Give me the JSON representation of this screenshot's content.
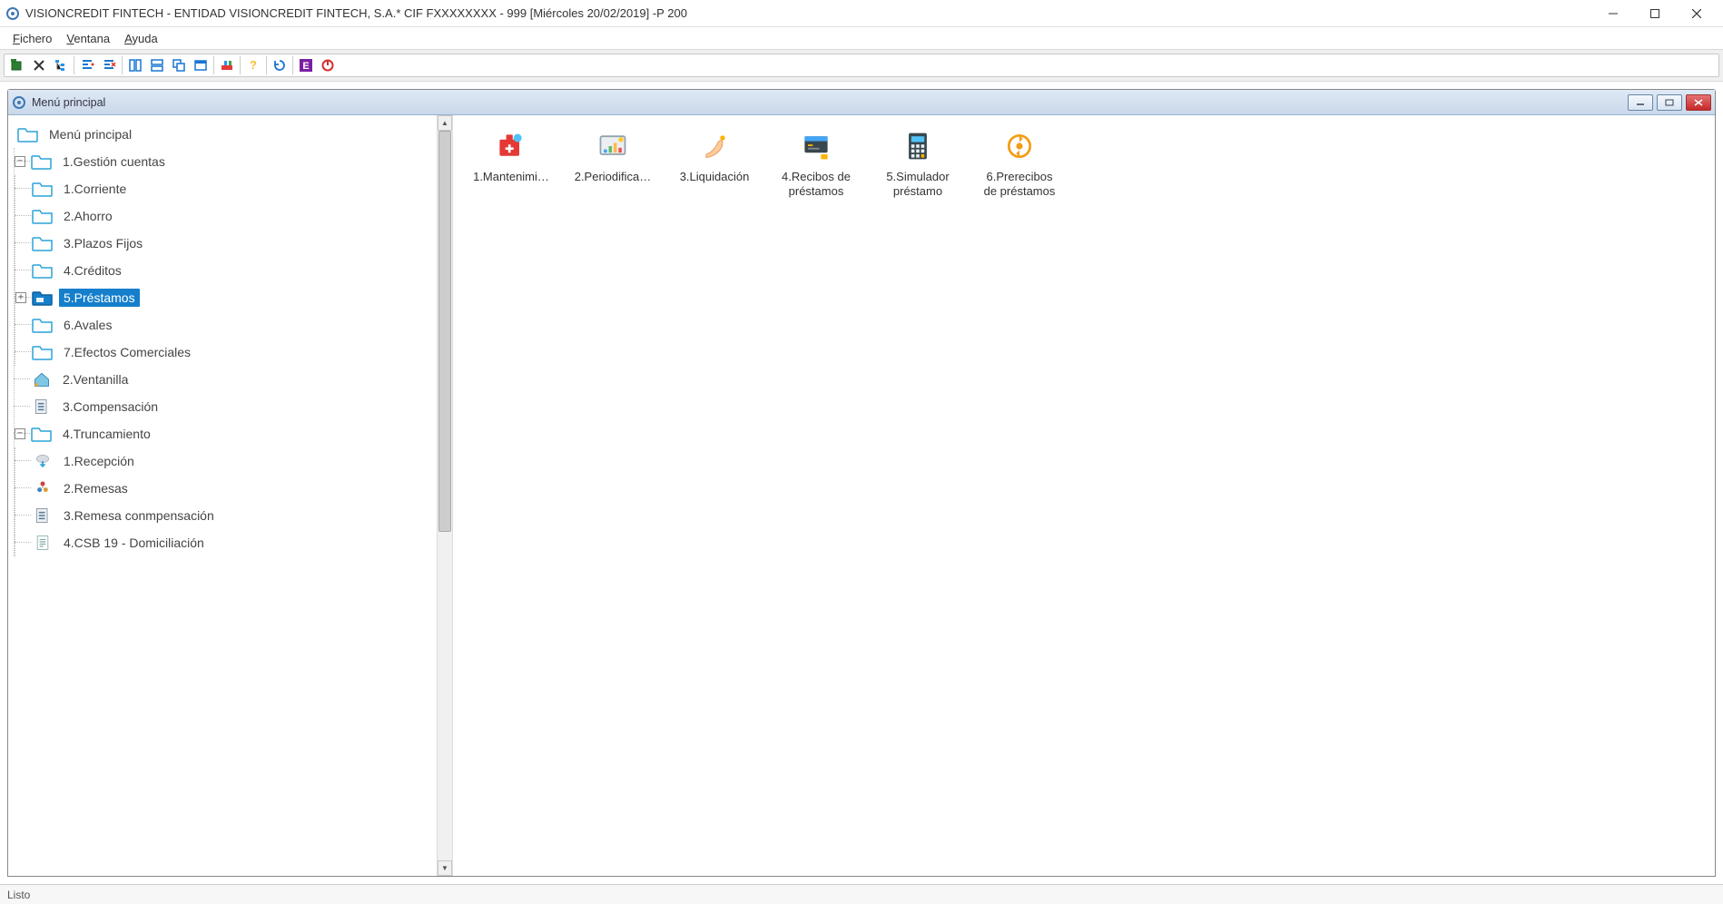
{
  "titlebar": {
    "title": "VISIONCREDIT FINTECH - ENTIDAD VISIONCREDIT FINTECH, S.A.* CIF FXXXXXXXX - 999 [Miércoles 20/02/2019] -P 200"
  },
  "menubar": {
    "items": [
      {
        "label": "Fichero",
        "accel": "F"
      },
      {
        "label": "Ventana",
        "accel": "V"
      },
      {
        "label": "Ayuda",
        "accel": "A"
      }
    ]
  },
  "toolbar": {
    "buttons": [
      "open-icon",
      "delete-icon",
      "tree-icon",
      "sep",
      "align-left-icon",
      "align-remove-icon",
      "sep",
      "columns-icon",
      "rows-icon",
      "cascade-icon",
      "window-icon",
      "sep",
      "tool-icon",
      "sep",
      "help-icon",
      "sep",
      "refresh-icon",
      "sep",
      "app-e-icon",
      "power-icon"
    ]
  },
  "mdi": {
    "title": "Menú principal"
  },
  "tree": {
    "root": "Menú principal",
    "selected": "5.Préstamos",
    "nodes": [
      {
        "label": "1.Gestión cuentas",
        "expanded": true,
        "children": [
          {
            "label": "1.Corriente"
          },
          {
            "label": "2.Ahorro"
          },
          {
            "label": "3.Plazos Fijos"
          },
          {
            "label": "4.Créditos"
          },
          {
            "label": "5.Préstamos",
            "expandable": true,
            "selected": true
          },
          {
            "label": "6.Avales"
          },
          {
            "label": "7.Efectos Comerciales"
          }
        ]
      },
      {
        "label": "2.Ventanilla",
        "icon": "house"
      },
      {
        "label": "3.Compensación",
        "icon": "doc"
      },
      {
        "label": "4.Truncamiento",
        "expanded": true,
        "children": [
          {
            "label": "1.Recepción",
            "icon": "cloud"
          },
          {
            "label": "2.Remesas",
            "icon": "people"
          },
          {
            "label": "3.Remesa conmpensación",
            "icon": "doc"
          },
          {
            "label": "4.CSB 19 - Domiciliación",
            "icon": "page"
          }
        ]
      }
    ]
  },
  "content": {
    "items": [
      {
        "label": "1.Mantenimi…",
        "icon": "maintain"
      },
      {
        "label": "2.Periodifica…",
        "icon": "period"
      },
      {
        "label": "3.Liquidación",
        "icon": "hand"
      },
      {
        "label_l1": "4.Recibos de",
        "label_l2": "préstamos",
        "icon": "receipt"
      },
      {
        "label_l1": "5.Simulador",
        "label_l2": "préstamo",
        "icon": "calc"
      },
      {
        "label_l1": "6.Prerecibos",
        "label_l2": "de préstamos",
        "icon": "cycle"
      }
    ]
  },
  "statusbar": {
    "text": "Listo"
  },
  "colors": {
    "selection": "#157fcc",
    "accent_orange": "#f39c12",
    "accent_red": "#e53935"
  }
}
